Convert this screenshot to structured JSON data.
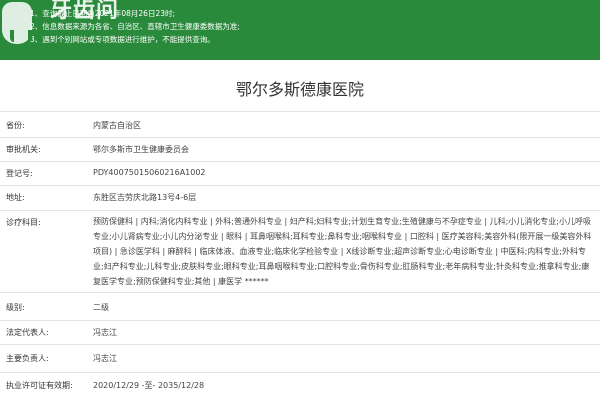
{
  "banner": {
    "line1": "1、查询截止日期为2021年08月26日23时;",
    "line2": "2、信息数据来源为各省、自治区、直辖市卫生健康委数据为准;",
    "line3": "3、遇到个别网站或专项数据进行维护，不能提供查询。",
    "logo_text": "牙齿问",
    "logo_icon": "tooth-logo-icon",
    "date_text": "26日23时;",
    "bg_color": "#2a8a3c"
  },
  "hospital": {
    "name": "鄂尔多斯德康医院"
  },
  "fields": [
    {
      "label": "省份:",
      "value": "内蒙古自治区"
    },
    {
      "label": "审批机关:",
      "value": "鄂尔多斯市卫生健康委员会"
    },
    {
      "label": "登记号:",
      "value": "PDY40075015060216A1002"
    },
    {
      "label": "地址:",
      "value": "东胜区吉劳庆北路13号4-6层"
    },
    {
      "label": "诊疗科目:",
      "value": "预防保健科 | 内科;消化内科专业 | 外科;普通外科专业 | 妇产科;妇科专业;计划生育专业;生殖健康与不孕症专业 | 儿科;小儿消化专业;小儿呼吸专业;小儿肾病专业;小儿内分泌专业 | 眼科 | 耳鼻咽喉科;耳科专业;鼻科专业;咽喉科专业 | 口腔科 | 医疗美容科;美容外科(限开展一级美容外科项目) | 急诊医学科 | 麻醉科 | 临床体液、血液专业;临床化学检验专业 | X线诊断专业;超声诊断专业;心电诊断专业 | 中医科;内科专业;外科专业;妇产科专业;儿科专业;皮肤科专业;眼科专业;耳鼻咽喉科专业;口腔科专业;骨伤科专业;肛肠科专业;老年病科专业;针灸科专业;推拿科专业;康复医学专业;预防保健科专业;其他 | 康医学 ******"
    },
    {
      "label": "级别:",
      "value": "二级"
    },
    {
      "label": "法定代表人:",
      "value": "冯志江"
    },
    {
      "label": "主要负责人:",
      "value": "冯志江"
    },
    {
      "label": "执业许可证有效期:",
      "value": "2020/12/29 -至- 2035/12/28"
    }
  ]
}
